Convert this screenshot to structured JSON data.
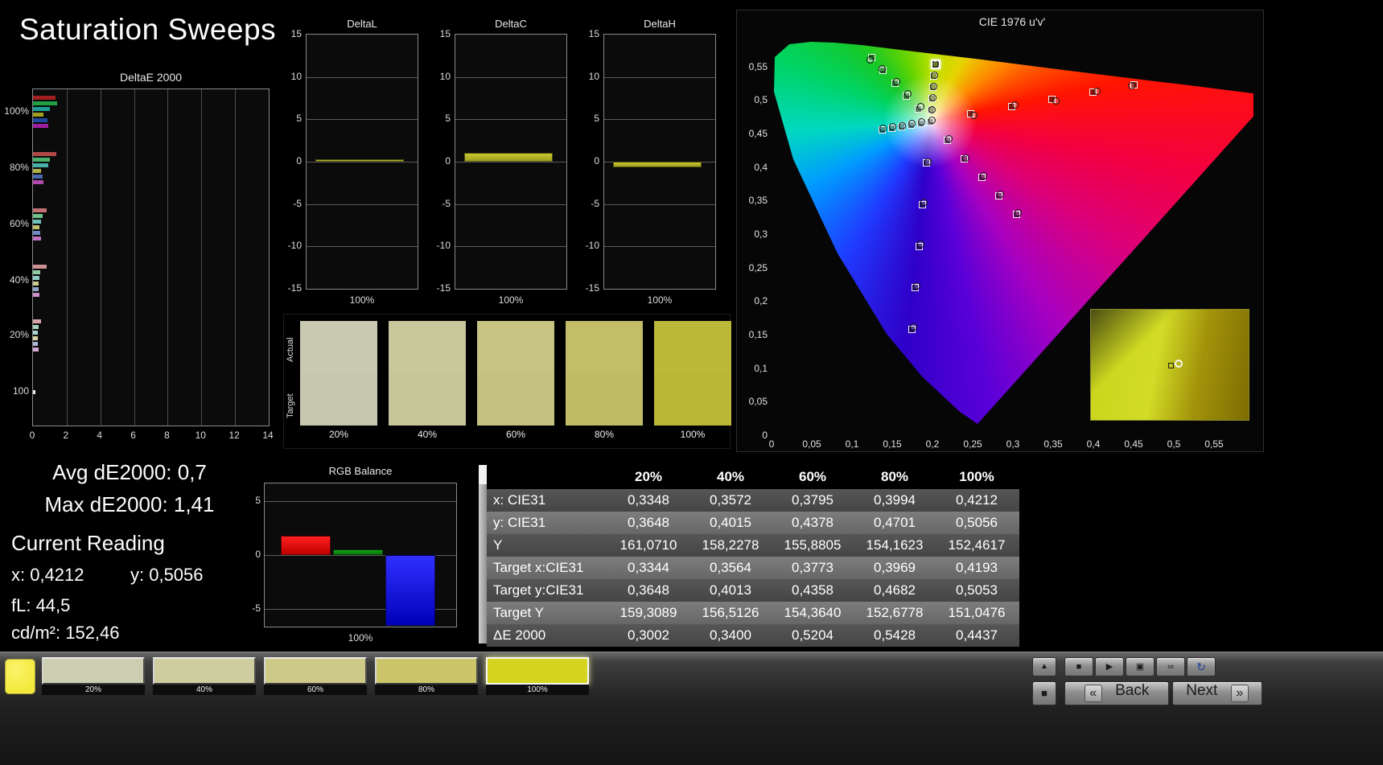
{
  "page": {
    "title": "Saturation Sweeps"
  },
  "de2000_chart": {
    "title": "DeltaE 2000",
    "x_ticks": [
      "0",
      "2",
      "4",
      "6",
      "8",
      "10",
      "12",
      "14"
    ],
    "x_max": 14,
    "groups": [
      {
        "label": "100%",
        "bars": [
          {
            "color": "#a02020",
            "value": 1.35
          },
          {
            "color": "#20a040",
            "value": 1.41
          },
          {
            "color": "#1f9e96",
            "value": 1.0
          },
          {
            "color": "#9e9e20",
            "value": 0.6
          },
          {
            "color": "#2048a0",
            "value": 0.85
          },
          {
            "color": "#9e209e",
            "value": 0.9
          }
        ]
      },
      {
        "label": "80%",
        "bars": [
          {
            "color": "#b04848",
            "value": 1.4
          },
          {
            "color": "#48b068",
            "value": 1.0
          },
          {
            "color": "#48b0a8",
            "value": 0.9
          },
          {
            "color": "#b0b048",
            "value": 0.5
          },
          {
            "color": "#4868b0",
            "value": 0.55
          },
          {
            "color": "#b048b0",
            "value": 0.6
          }
        ]
      },
      {
        "label": "60%",
        "bars": [
          {
            "color": "#c07070",
            "value": 0.8
          },
          {
            "color": "#70c08c",
            "value": 0.55
          },
          {
            "color": "#70c0ba",
            "value": 0.5
          },
          {
            "color": "#c0c070",
            "value": 0.4
          },
          {
            "color": "#7088c0",
            "value": 0.45
          },
          {
            "color": "#c070c0",
            "value": 0.5
          }
        ]
      },
      {
        "label": "40%",
        "bars": [
          {
            "color": "#cc9090",
            "value": 0.8
          },
          {
            "color": "#90cca8",
            "value": 0.45
          },
          {
            "color": "#90ccc6",
            "value": 0.4
          },
          {
            "color": "#cccc90",
            "value": 0.35
          },
          {
            "color": "#90a4cc",
            "value": 0.35
          },
          {
            "color": "#cc90cc",
            "value": 0.4
          }
        ]
      },
      {
        "label": "20%",
        "bars": [
          {
            "color": "#d4a8a8",
            "value": 0.5
          },
          {
            "color": "#a8d4bc",
            "value": 0.35
          },
          {
            "color": "#a8d4d0",
            "value": 0.3
          },
          {
            "color": "#d4d4a8",
            "value": 0.3
          },
          {
            "color": "#a8b8d4",
            "value": 0.3
          },
          {
            "color": "#d4a8d4",
            "value": 0.35
          }
        ]
      },
      {
        "label": "100",
        "bars": [
          {
            "color": "#e8e8e8",
            "value": 0.15
          }
        ]
      }
    ]
  },
  "delta_charts": [
    {
      "title": "DeltaL",
      "x_label": "100%",
      "y_ticks": [
        "15",
        "10",
        "5",
        "0",
        "-5",
        "-10",
        "-15"
      ],
      "y_max": 15,
      "bar_value": 0.15
    },
    {
      "title": "DeltaC",
      "x_label": "100%",
      "y_ticks": [
        "15",
        "10",
        "5",
        "0",
        "-5",
        "-10",
        "-15"
      ],
      "y_max": 15,
      "bar_value": 1.0
    },
    {
      "title": "DeltaH",
      "x_label": "100%",
      "y_ticks": [
        "15",
        "10",
        "5",
        "0",
        "-5",
        "-10",
        "-15"
      ],
      "y_max": 15,
      "bar_value": -0.7
    }
  ],
  "swatch_panel": {
    "row_labels": [
      "Actual",
      "Target"
    ],
    "items": [
      {
        "label": "20%",
        "actual": "#c9c9b2",
        "target": "#c7c7b0"
      },
      {
        "label": "40%",
        "actual": "#c9c79c",
        "target": "#c7c59a"
      },
      {
        "label": "60%",
        "actual": "#c6c383",
        "target": "#c4c181"
      },
      {
        "label": "80%",
        "actual": "#c2bd68",
        "target": "#c0bb66"
      },
      {
        "label": "100%",
        "actual": "#bcb839",
        "target": "#bab637"
      }
    ]
  },
  "cie_chart": {
    "title": "CIE 1976 u'v'",
    "u_max": 0.6,
    "v_max": 0.6,
    "x_ticks": [
      {
        "label": "0",
        "value": 0
      },
      {
        "label": "0,05",
        "value": 0.05
      },
      {
        "label": "0,1",
        "value": 0.1
      },
      {
        "label": "0,15",
        "value": 0.15
      },
      {
        "label": "0,2",
        "value": 0.2
      },
      {
        "label": "0,25",
        "value": 0.25
      },
      {
        "label": "0,3",
        "value": 0.3
      },
      {
        "label": "0,35",
        "value": 0.35
      },
      {
        "label": "0,4",
        "value": 0.4
      },
      {
        "label": "0,45",
        "value": 0.45
      },
      {
        "label": "0,5",
        "value": 0.5
      },
      {
        "label": "0,55",
        "value": 0.55
      }
    ],
    "y_ticks": [
      {
        "label": "0,55",
        "value": 0.55
      },
      {
        "label": "0,5",
        "value": 0.5
      },
      {
        "label": "0,45",
        "value": 0.45
      },
      {
        "label": "0,4",
        "value": 0.4
      },
      {
        "label": "0,35",
        "value": 0.35
      },
      {
        "label": "0,3",
        "value": 0.3
      },
      {
        "label": "0,25",
        "value": 0.25
      },
      {
        "label": "0,2",
        "value": 0.2
      },
      {
        "label": "0,15",
        "value": 0.15
      },
      {
        "label": "0,1",
        "value": 0.1
      },
      {
        "label": "0,05",
        "value": 0.05
      },
      {
        "label": "0",
        "value": 0
      }
    ],
    "white_point": {
      "u": 0.198,
      "v": 0.468
    },
    "current": {
      "u": 0.2049,
      "v": 0.5533
    },
    "series": [
      {
        "name": "red",
        "targets": [
          [
            0.2486,
            0.479
          ],
          [
            0.2992,
            0.49
          ],
          [
            0.3498,
            0.501
          ],
          [
            0.4004,
            0.512
          ],
          [
            0.451,
            0.523
          ]
        ],
        "measured": [
          [
            0.2525,
            0.477
          ],
          [
            0.303,
            0.4925
          ],
          [
            0.3545,
            0.499
          ],
          [
            0.405,
            0.5135
          ],
          [
            0.448,
            0.521
          ]
        ]
      },
      {
        "name": "green",
        "targets": [
          [
            0.1834,
            0.487
          ],
          [
            0.1688,
            0.506
          ],
          [
            0.1542,
            0.525
          ],
          [
            0.1396,
            0.544
          ],
          [
            0.125,
            0.563
          ]
        ],
        "measured": [
          [
            0.186,
            0.49
          ],
          [
            0.17,
            0.509
          ],
          [
            0.156,
            0.528
          ],
          [
            0.138,
            0.547
          ],
          [
            0.123,
            0.56
          ]
        ]
      },
      {
        "name": "blue",
        "targets": [
          [
            0.1934,
            0.406
          ],
          [
            0.1888,
            0.344
          ],
          [
            0.1842,
            0.282
          ],
          [
            0.1796,
            0.22
          ],
          [
            0.175,
            0.158
          ]
        ],
        "measured": [
          [
            0.195,
            0.408
          ],
          [
            0.19,
            0.347
          ],
          [
            0.186,
            0.285
          ],
          [
            0.181,
            0.223
          ],
          [
            0.177,
            0.162
          ]
        ]
      },
      {
        "name": "cyan",
        "targets": [
          [
            0.186,
            0.4656
          ],
          [
            0.174,
            0.4632
          ],
          [
            0.162,
            0.4608
          ],
          [
            0.15,
            0.4584
          ],
          [
            0.138,
            0.456
          ]
        ],
        "measured": [
          [
            0.187,
            0.467
          ],
          [
            0.1755,
            0.4645
          ],
          [
            0.1635,
            0.462
          ],
          [
            0.1515,
            0.46
          ],
          [
            0.1395,
            0.4575
          ]
        ]
      },
      {
        "name": "magenta",
        "targets": [
          [
            0.2194,
            0.4404
          ],
          [
            0.2408,
            0.4128
          ],
          [
            0.2622,
            0.3852
          ],
          [
            0.2836,
            0.3576
          ],
          [
            0.305,
            0.33
          ]
        ],
        "measured": [
          [
            0.221,
            0.442
          ],
          [
            0.2425,
            0.414
          ],
          [
            0.264,
            0.387
          ],
          [
            0.285,
            0.359
          ],
          [
            0.307,
            0.332
          ]
        ]
      },
      {
        "name": "yellow",
        "targets": [
          [
            0.1992,
            0.485
          ],
          [
            0.2004,
            0.502
          ],
          [
            0.2016,
            0.519
          ],
          [
            0.2028,
            0.536
          ],
          [
            0.204,
            0.553
          ]
        ],
        "measured": [
          [
            0.2,
            0.486
          ],
          [
            0.201,
            0.503
          ],
          [
            0.2025,
            0.52
          ],
          [
            0.2035,
            0.537
          ],
          [
            0.2049,
            0.5533
          ]
        ]
      }
    ]
  },
  "stats": {
    "avg_label": "Avg dE2000: 0,7",
    "max_label": "Max dE2000: 1,41",
    "current_heading": "Current Reading",
    "x_label": "x: 0,4212",
    "y_label": "y: 0,5056",
    "fl_label": "fL: 44,5",
    "cdm2_label": "cd/m²: 152,46"
  },
  "rgb_chart": {
    "title": "RGB Balance",
    "x_label": "100%",
    "y_ticks": [
      {
        "label": "5",
        "value": 5
      },
      {
        "label": "0",
        "value": 0
      },
      {
        "label": "-5",
        "value": -5
      }
    ],
    "y_range": 6.6,
    "bars": [
      {
        "name": "red",
        "color_top": "#ff2020",
        "color_bottom": "#c00000",
        "value": 1.8
      },
      {
        "name": "green",
        "color_top": "#18a018",
        "color_bottom": "#077a0c",
        "value": 0.5
      },
      {
        "name": "blue",
        "color_top": "#3030ff",
        "color_bottom": "#0000b8",
        "value": -6.5
      }
    ]
  },
  "table": {
    "headers": [
      "20%",
      "40%",
      "60%",
      "80%",
      "100%"
    ],
    "rows": [
      {
        "label": "x: CIE31",
        "values": [
          "0,3348",
          "0,3572",
          "0,3795",
          "0,3994",
          "0,4212"
        ]
      },
      {
        "label": "y: CIE31",
        "values": [
          "0,3648",
          "0,4015",
          "0,4378",
          "0,4701",
          "0,5056"
        ]
      },
      {
        "label": "Y",
        "values": [
          "161,0710",
          "158,2278",
          "155,8805",
          "154,1623",
          "152,4617"
        ]
      },
      {
        "label": "Target x:CIE31",
        "values": [
          "0,3344",
          "0,3564",
          "0,3773",
          "0,3969",
          "0,4193"
        ]
      },
      {
        "label": "Target y:CIE31",
        "values": [
          "0,3648",
          "0,4013",
          "0,4358",
          "0,4682",
          "0,5053"
        ]
      },
      {
        "label": "Target Y",
        "values": [
          "159,3089",
          "156,5126",
          "154,3640",
          "152,6778",
          "151,0476"
        ]
      },
      {
        "label": "ΔE 2000",
        "values": [
          "0,3002",
          "0,3400",
          "0,5204",
          "0,5428",
          "0,4437"
        ]
      }
    ]
  },
  "bottom_bar": {
    "color_patch": "#f2e93c",
    "swatches": [
      {
        "label": "20%",
        "color": "#cdcdb2",
        "selected": false
      },
      {
        "label": "40%",
        "color": "#cecda0",
        "selected": false
      },
      {
        "label": "60%",
        "color": "#cdc987",
        "selected": false
      },
      {
        "label": "80%",
        "color": "#cbc468",
        "selected": false
      },
      {
        "label": "100%",
        "color": "#d6d321",
        "selected": true
      }
    ],
    "up_icon": "▲",
    "square_icon": "■",
    "transport": [
      {
        "name": "stop",
        "icon": "■"
      },
      {
        "name": "play",
        "icon": "▶"
      },
      {
        "name": "record",
        "icon": "▣"
      },
      {
        "name": "loop",
        "icon": "∞"
      },
      {
        "name": "refresh",
        "icon": "↻"
      }
    ],
    "back": {
      "label": "Back",
      "icon": "«"
    },
    "next": {
      "label": "Next",
      "icon": "»"
    }
  }
}
